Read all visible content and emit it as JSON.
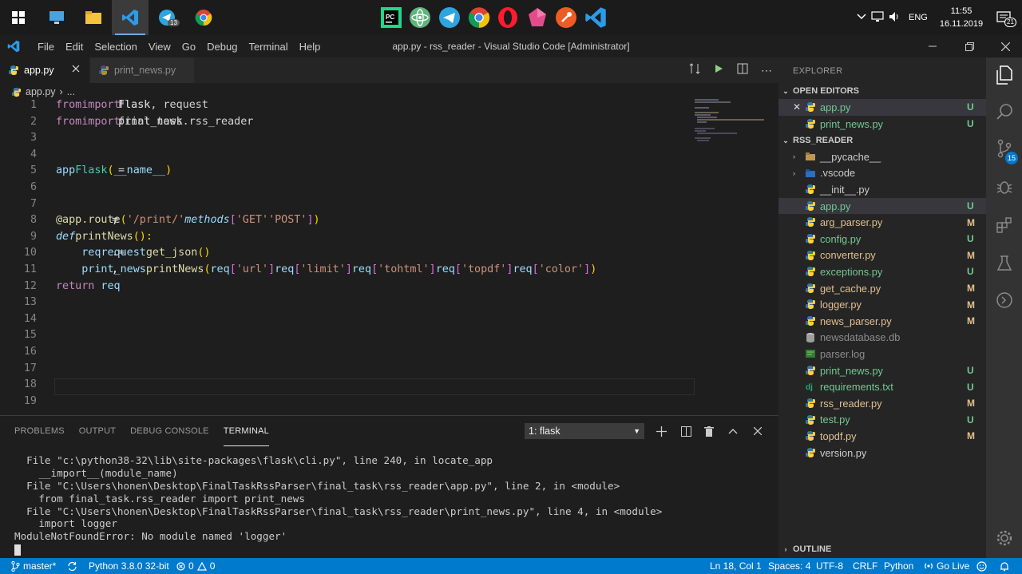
{
  "taskbar": {
    "clock_time": "11:55",
    "clock_date": "16.11.2019",
    "language": "ENG",
    "notification_count": "21",
    "telegram_badge": "13"
  },
  "titlebar": {
    "title": "app.py - rss_reader - Visual Studio Code [Administrator]",
    "menu": [
      "File",
      "Edit",
      "Selection",
      "View",
      "Go",
      "Debug",
      "Terminal",
      "Help"
    ]
  },
  "tabs": [
    {
      "label": "app.py",
      "active": true
    },
    {
      "label": "print_news.py",
      "active": false
    }
  ],
  "breadcrumb": {
    "file": "app.py",
    "more": "..."
  },
  "code": {
    "line_numbers": [
      "1",
      "2",
      "3",
      "4",
      "5",
      "6",
      "7",
      "8",
      "9",
      "10",
      "11",
      "12",
      "13",
      "14",
      "15",
      "16",
      "17",
      "18",
      "19"
    ],
    "lines": [
      [
        {
          "t": "from",
          "c": "kw2"
        },
        {
          "t": " flask ",
          "c": "txt"
        },
        {
          "t": "import",
          "c": "kw2"
        },
        {
          "t": " Flask, request",
          "c": "txt"
        }
      ],
      [
        {
          "t": "from",
          "c": "kw2"
        },
        {
          "t": " final_task.rss_reader ",
          "c": "txt"
        },
        {
          "t": "import",
          "c": "kw2"
        },
        {
          "t": " print_news",
          "c": "txt"
        }
      ],
      [],
      [],
      [
        {
          "t": "app",
          "c": "id"
        },
        {
          "t": " = ",
          "c": "txt"
        },
        {
          "t": "Flask",
          "c": "cls"
        },
        {
          "t": "(",
          "c": "par"
        },
        {
          "t": "__name__",
          "c": "id"
        },
        {
          "t": ")",
          "c": "par"
        }
      ],
      [],
      [],
      [
        {
          "t": "@app.route",
          "c": "dec"
        },
        {
          "t": "(",
          "c": "par"
        },
        {
          "t": "'/print/'",
          "c": "str"
        },
        {
          "t": ", ",
          "c": "txt"
        },
        {
          "t": "methods",
          "c": "it"
        },
        {
          "t": "=",
          "c": "txt"
        },
        {
          "t": "[",
          "c": "par2"
        },
        {
          "t": "'GET'",
          "c": "str"
        },
        {
          "t": ", ",
          "c": "txt"
        },
        {
          "t": "'POST'",
          "c": "str"
        },
        {
          "t": "]",
          "c": "par2"
        },
        {
          "t": ")",
          "c": "par"
        }
      ],
      [
        {
          "t": "def",
          "c": "kw it"
        },
        {
          "t": " ",
          "c": "txt"
        },
        {
          "t": "printNews",
          "c": "fn"
        },
        {
          "t": "():",
          "c": "par"
        }
      ],
      [
        {
          "t": "    req",
          "c": "id"
        },
        {
          "t": " = ",
          "c": "txt"
        },
        {
          "t": "request",
          "c": "id"
        },
        {
          "t": ".",
          "c": "txt"
        },
        {
          "t": "get_json",
          "c": "fn"
        },
        {
          "t": "()",
          "c": "par"
        }
      ],
      [
        {
          "t": "    print_news",
          "c": "id"
        },
        {
          "t": ".",
          "c": "txt"
        },
        {
          "t": "printNews",
          "c": "fn"
        },
        {
          "t": "(",
          "c": "par"
        },
        {
          "t": "req",
          "c": "id"
        },
        {
          "t": "[",
          "c": "par2"
        },
        {
          "t": "'url'",
          "c": "str"
        },
        {
          "t": "]",
          "c": "par2"
        },
        {
          "t": ", ",
          "c": "txt"
        },
        {
          "t": "req",
          "c": "id"
        },
        {
          "t": "[",
          "c": "par2"
        },
        {
          "t": "'limit'",
          "c": "str"
        },
        {
          "t": "]",
          "c": "par2"
        },
        {
          "t": ", ",
          "c": "txt"
        },
        {
          "t": "req",
          "c": "id"
        },
        {
          "t": "[",
          "c": "par2"
        },
        {
          "t": "'tohtml'",
          "c": "str"
        },
        {
          "t": "]",
          "c": "par2"
        },
        {
          "t": ", ",
          "c": "txt"
        },
        {
          "t": "req",
          "c": "id"
        },
        {
          "t": "[",
          "c": "par2"
        },
        {
          "t": "'topdf'",
          "c": "str"
        },
        {
          "t": "]",
          "c": "par2"
        },
        {
          "t": ", ",
          "c": "txt"
        },
        {
          "t": "req",
          "c": "id"
        },
        {
          "t": "[",
          "c": "par2"
        },
        {
          "t": "'color'",
          "c": "str"
        },
        {
          "t": "]",
          "c": "par2"
        },
        {
          "t": ")",
          "c": "par"
        }
      ],
      [
        {
          "t": "    ",
          "c": "txt"
        },
        {
          "t": "return",
          "c": "kw2"
        },
        {
          "t": " req",
          "c": "id"
        }
      ],
      [],
      [],
      [],
      [],
      [],
      [],
      []
    ]
  },
  "panel": {
    "tabs": [
      "PROBLEMS",
      "OUTPUT",
      "DEBUG CONSOLE",
      "TERMINAL"
    ],
    "terminal_select": "1: flask",
    "terminal_lines": [
      "  File \"c:\\python38-32\\lib\\site-packages\\flask\\cli.py\", line 240, in locate_app",
      "    __import__(module_name)",
      "  File \"C:\\Users\\honen\\Desktop\\FinalTaskRssParser\\final_task\\rss_reader\\app.py\", line 2, in <module>",
      "    from final_task.rss_reader import print_news",
      "  File \"C:\\Users\\honen\\Desktop\\FinalTaskRssParser\\final_task\\rss_reader\\print_news.py\", line 4, in <module>",
      "    import logger",
      "ModuleNotFoundError: No module named 'logger'"
    ]
  },
  "explorer": {
    "header": "EXPLORER",
    "open_editors_title": "OPEN EDITORS",
    "open_editors": [
      {
        "name": "app.py",
        "status": "U",
        "color": "u"
      },
      {
        "name": "print_news.py",
        "status": "U",
        "color": "u"
      }
    ],
    "folder_title": "RSS_READER",
    "files": [
      {
        "name": "__pycache__",
        "status": "",
        "color": "n",
        "icon": "folder"
      },
      {
        "name": ".vscode",
        "status": "",
        "color": "n",
        "icon": "folder-vscode"
      },
      {
        "name": "__init__.py",
        "status": "",
        "color": "n",
        "icon": "py"
      },
      {
        "name": "app.py",
        "status": "U",
        "color": "u",
        "icon": "py"
      },
      {
        "name": "arg_parser.py",
        "status": "M",
        "color": "m",
        "icon": "py"
      },
      {
        "name": "config.py",
        "status": "U",
        "color": "u",
        "icon": "py"
      },
      {
        "name": "converter.py",
        "status": "M",
        "color": "m",
        "icon": "py"
      },
      {
        "name": "exceptions.py",
        "status": "U",
        "color": "u",
        "icon": "py"
      },
      {
        "name": "get_cache.py",
        "status": "M",
        "color": "m",
        "icon": "py"
      },
      {
        "name": "logger.py",
        "status": "M",
        "color": "m",
        "icon": "py"
      },
      {
        "name": "news_parser.py",
        "status": "M",
        "color": "m",
        "icon": "py"
      },
      {
        "name": "newsdatabase.db",
        "status": "",
        "color": "g",
        "icon": "db"
      },
      {
        "name": "parser.log",
        "status": "",
        "color": "g",
        "icon": "log"
      },
      {
        "name": "print_news.py",
        "status": "U",
        "color": "u",
        "icon": "py"
      },
      {
        "name": "requirements.txt",
        "status": "U",
        "color": "u",
        "icon": "dj"
      },
      {
        "name": "rss_reader.py",
        "status": "M",
        "color": "m",
        "icon": "py"
      },
      {
        "name": "test.py",
        "status": "U",
        "color": "u",
        "icon": "py"
      },
      {
        "name": "topdf.py",
        "status": "M",
        "color": "m",
        "icon": "py"
      },
      {
        "name": "version.py",
        "status": "",
        "color": "n",
        "icon": "py"
      }
    ],
    "outline_title": "OUTLINE",
    "scm_badge": "15"
  },
  "statusbar": {
    "branch": "master*",
    "python": "Python 3.8.0 32-bit",
    "errors": "0",
    "warnings": "0",
    "position": "Ln 18, Col 1",
    "spaces": "Spaces: 4",
    "encoding": "UTF-8",
    "eol": "CRLF",
    "language": "Python",
    "golive": "Go Live"
  },
  "colors": {
    "accent": "#007acc",
    "modified": "#e2c08d",
    "untracked": "#73c991"
  }
}
